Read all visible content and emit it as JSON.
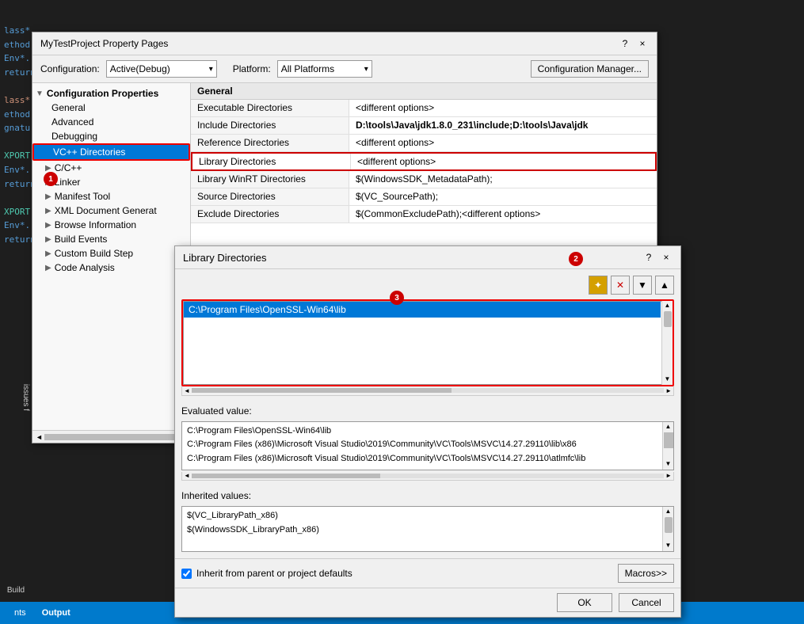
{
  "ide": {
    "bg_text_lines": [
      "lass*",
      "ethod:",
      "Env*.",
      "return",
      "",
      "lass*:",
      "ethod:",
      "gnatu",
      "",
      "XPORT",
      "Env*.",
      "return",
      "",
      "XPORT",
      "Env*.",
      "return"
    ]
  },
  "bottom_bar": {
    "tabs": [
      "nts",
      "Output"
    ]
  },
  "property_dialog": {
    "title": "MyTestProject Property Pages",
    "question_btn": "?",
    "close_btn": "×",
    "config_label": "Configuration:",
    "config_value": "Active(Debug)",
    "platform_label": "Platform:",
    "platform_value": "All Platforms",
    "config_mgr_label": "Configuration Manager...",
    "tree": {
      "root": "Configuration Properties",
      "items": [
        {
          "label": "General",
          "indent": 1,
          "expandable": false
        },
        {
          "label": "Advanced",
          "indent": 1,
          "expandable": false
        },
        {
          "label": "Debugging",
          "indent": 1,
          "expandable": false
        },
        {
          "label": "VC++ Directories",
          "indent": 1,
          "expandable": false,
          "selected": true
        },
        {
          "label": "C/C++",
          "indent": 1,
          "expandable": true
        },
        {
          "label": "Linker",
          "indent": 1,
          "expandable": true
        },
        {
          "label": "Manifest Tool",
          "indent": 1,
          "expandable": true
        },
        {
          "label": "XML Document Generator",
          "indent": 1,
          "expandable": true
        },
        {
          "label": "Browse Information",
          "indent": 1,
          "expandable": true
        },
        {
          "label": "Build Events",
          "indent": 1,
          "expandable": true
        },
        {
          "label": "Custom Build Step",
          "indent": 1,
          "expandable": true
        },
        {
          "label": "Code Analysis",
          "indent": 1,
          "expandable": true
        }
      ]
    },
    "properties": {
      "section": "General",
      "rows": [
        {
          "name": "Executable Directories",
          "value": "<different options>"
        },
        {
          "name": "Include Directories",
          "value": "D:\\tools\\Java\\jdk1.8.0_231\\include;D:\\tools\\Java\\jdk",
          "bold": true
        },
        {
          "name": "Reference Directories",
          "value": "<different options>"
        },
        {
          "name": "Library Directories",
          "value": "<different options>",
          "highlighted": true
        },
        {
          "name": "Library WinRT Directories",
          "value": "$(WindowsSDK_MetadataPath);"
        },
        {
          "name": "Source Directories",
          "value": "$(VC_SourcePath);"
        },
        {
          "name": "Exclude Directories",
          "value": "$(CommonExcludePath);<different options>"
        }
      ]
    }
  },
  "lib_dialog": {
    "title": "Library Directories",
    "question_btn": "?",
    "close_btn": "×",
    "toolbar_buttons": [
      "add",
      "delete",
      "move_down",
      "move_up"
    ],
    "entries": [
      {
        "value": "C:\\Program Files\\OpenSSL-Win64\\lib",
        "selected": true
      },
      {
        "value": ""
      },
      {
        "value": ""
      }
    ],
    "eval_label": "Evaluated value:",
    "eval_lines": [
      "C:\\Program Files\\OpenSSL-Win64\\lib",
      "C:\\Program Files (x86)\\Microsoft Visual Studio\\2019\\Community\\VC\\Tools\\MSVC\\14.27.29110\\lib\\x86",
      "C:\\Program Files (x86)\\Microsoft Visual Studio\\2019\\Community\\VC\\Tools\\MSVC\\14.27.29110\\atlmfc\\lib"
    ],
    "inherited_label": "Inherited values:",
    "inherited_lines": [
      "$(VC_LibraryPath_x86)",
      "$(WindowsSDK_LibraryPath_x86)"
    ],
    "inherit_checkbox_label": "Inherit from parent or project defaults",
    "inherit_checked": true,
    "macros_btn": "Macros>>",
    "ok_btn": "OK",
    "cancel_btn": "Cancel"
  },
  "badges": {
    "b1": "1",
    "b2": "2",
    "b3": "3"
  }
}
